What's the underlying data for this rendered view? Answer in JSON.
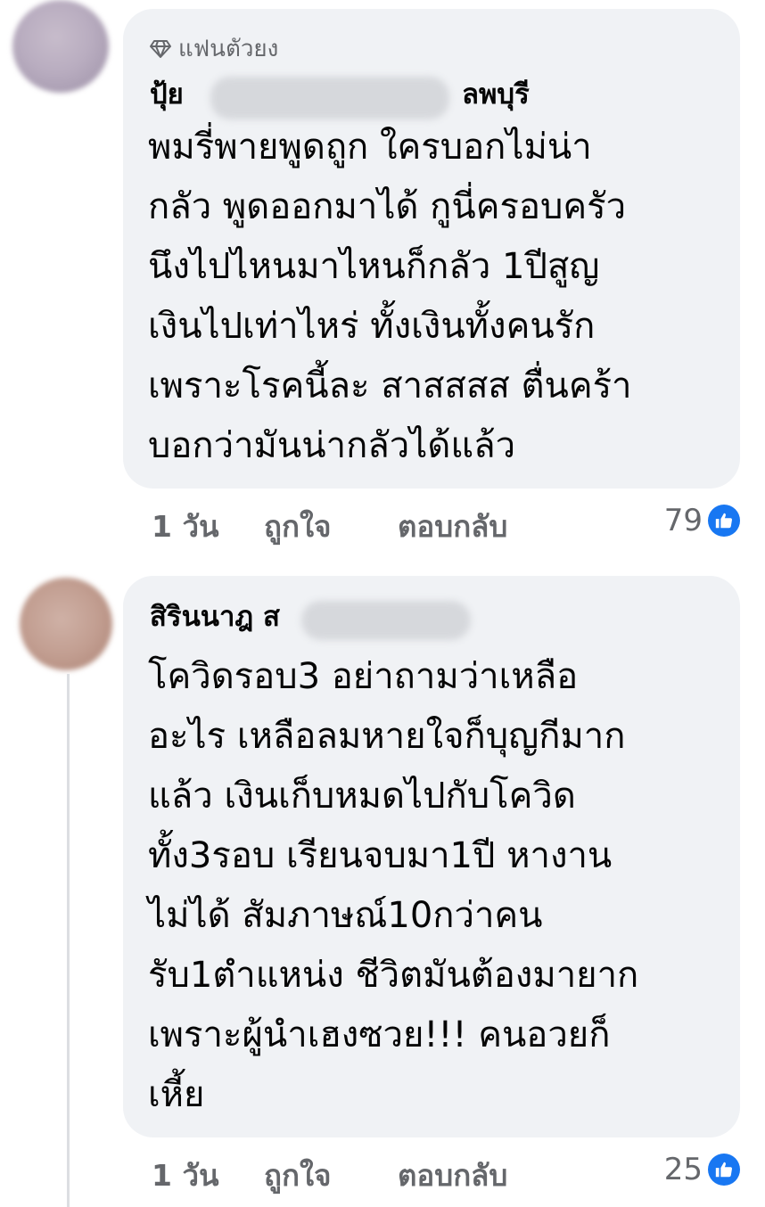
{
  "comments": [
    {
      "badge": "แฟนตัวยง",
      "author_visible": "ปุ้ย",
      "author_suffix": "ลพบุรี",
      "lines": [
        "พมรี่พายพูดถูก ใครบอกไม่น่า",
        "กลัว พูดออกมาได้ กูนี่ครอบครัว",
        "นึงไปไหนมาไหนก็กลัว 1ปีสูญ",
        "เงินไปเท่าไหร่ ทั้งเงินทั้งคนรัก",
        "เพราะโรคนี้ละ สาสสสส ตื่นคร้า",
        "บอกว่ามันน่ากลัวได้แล้ว"
      ],
      "time": "1 วัน",
      "like_label": "ถูกใจ",
      "reply_label": "ตอบกลับ",
      "reaction_count": "79",
      "reaction_icon": "thumbs-up-icon"
    },
    {
      "author_visible": "สิรินนาฎ ส",
      "lines": [
        "โควิดรอบ3 อย่าถามว่าเหลือ",
        "อะไร เหลือลมหายใจก็บุญกีมาก",
        "แล้ว เงินเก็บหมดไปกับโควิด",
        "ทั้ง3รอบ เรียนจบมา1ปี หางาน",
        "ไม่ได้ สัมภาษณ์10กว่าคน",
        "รับ1ตำแหน่ง ชีวิตมันต้องมายาก",
        "เพราะผู้นำเฮงซวย!!! คนอวยก็",
        "เหี้ย"
      ],
      "time": "1 วัน",
      "like_label": "ถูกใจ",
      "reply_label": "ตอบกลับ",
      "reaction_count": "25",
      "reaction_icon": "thumbs-up-icon"
    }
  ],
  "colors": {
    "bubble": "#f0f2f5",
    "meta_text": "#65676b",
    "like_blue": "#1877f2"
  }
}
